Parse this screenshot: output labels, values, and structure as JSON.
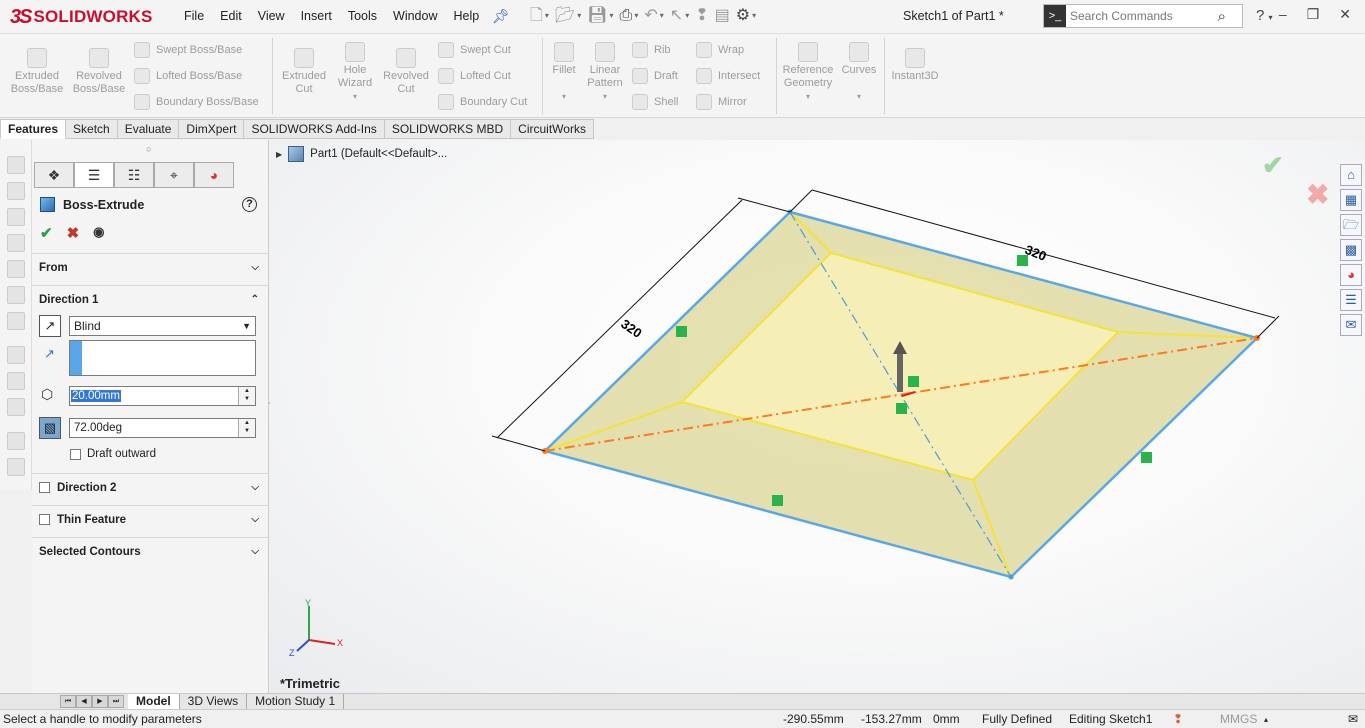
{
  "app": {
    "logo_prefix": "3S",
    "logo_brand": "SOLIDWORKS",
    "menus": [
      "File",
      "Edit",
      "View",
      "Insert",
      "Tools",
      "Window",
      "Help"
    ],
    "document_title": "Sketch1 of Part1 *",
    "search_placeholder": "Search Commands",
    "help_glyph": "?"
  },
  "command_manager": {
    "large": [
      {
        "id": "extruded-boss",
        "label": "Extruded\nBoss/Base"
      },
      {
        "id": "revolved-boss",
        "label": "Revolved\nBoss/Base"
      },
      {
        "id": "extruded-cut",
        "label": "Extruded\nCut"
      },
      {
        "id": "hole-wizard",
        "label": "Hole\nWizard"
      },
      {
        "id": "revolved-cut",
        "label": "Revolved\nCut"
      },
      {
        "id": "fillet",
        "label": "Fillet"
      },
      {
        "id": "linear-pattern",
        "label": "Linear\nPattern"
      },
      {
        "id": "reference-geometry",
        "label": "Reference\nGeometry"
      },
      {
        "id": "curves",
        "label": "Curves"
      },
      {
        "id": "instant3d",
        "label": "Instant3D"
      }
    ],
    "small": [
      {
        "id": "swept-boss",
        "label": "Swept Boss/Base"
      },
      {
        "id": "lofted-boss",
        "label": "Lofted Boss/Base"
      },
      {
        "id": "boundary-boss",
        "label": "Boundary Boss/Base"
      },
      {
        "id": "swept-cut",
        "label": "Swept Cut"
      },
      {
        "id": "lofted-cut",
        "label": "Lofted Cut"
      },
      {
        "id": "boundary-cut",
        "label": "Boundary Cut"
      },
      {
        "id": "rib",
        "label": "Rib"
      },
      {
        "id": "draft",
        "label": "Draft"
      },
      {
        "id": "shell",
        "label": "Shell"
      },
      {
        "id": "wrap",
        "label": "Wrap"
      },
      {
        "id": "intersect",
        "label": "Intersect"
      },
      {
        "id": "mirror",
        "label": "Mirror"
      }
    ]
  },
  "tabs": [
    "Features",
    "Sketch",
    "Evaluate",
    "DimXpert",
    "SOLIDWORKS Add-Ins",
    "SOLIDWORKS MBD",
    "CircuitWorks"
  ],
  "property_manager": {
    "title": "Boss-Extrude",
    "help": "?",
    "from_label": "From",
    "direction1_label": "Direction 1",
    "end_condition": "Blind",
    "depth": "20.00mm",
    "draft_angle": "72.00deg",
    "draft_outward_label": "Draft outward",
    "direction2_label": "Direction 2",
    "thin_feature_label": "Thin Feature",
    "selected_contours_label": "Selected Contours"
  },
  "viewport": {
    "tree_label": "Part1  (Default<<Default>...",
    "dimension_left": "320",
    "dimension_right": "320",
    "view_name": "*Trimetric",
    "axis_x": "X",
    "axis_y": "Y",
    "axis_z": "Z",
    "colors": {
      "outer_edge": "#5aa7e8",
      "inner_edge": "#f3e33a",
      "face": "#d6cf8f",
      "centerline": "#ff7a1a",
      "relation_glyph": "#29b34a"
    }
  },
  "bottom_tabs": [
    "Model",
    "3D Views",
    "Motion Study 1"
  ],
  "status": {
    "message": "Select a handle to modify parameters",
    "x": "-290.55mm",
    "y": "-153.27mm",
    "z": "0mm",
    "state": "Fully Defined",
    "editing": "Editing Sketch1",
    "units": "MMGS"
  }
}
